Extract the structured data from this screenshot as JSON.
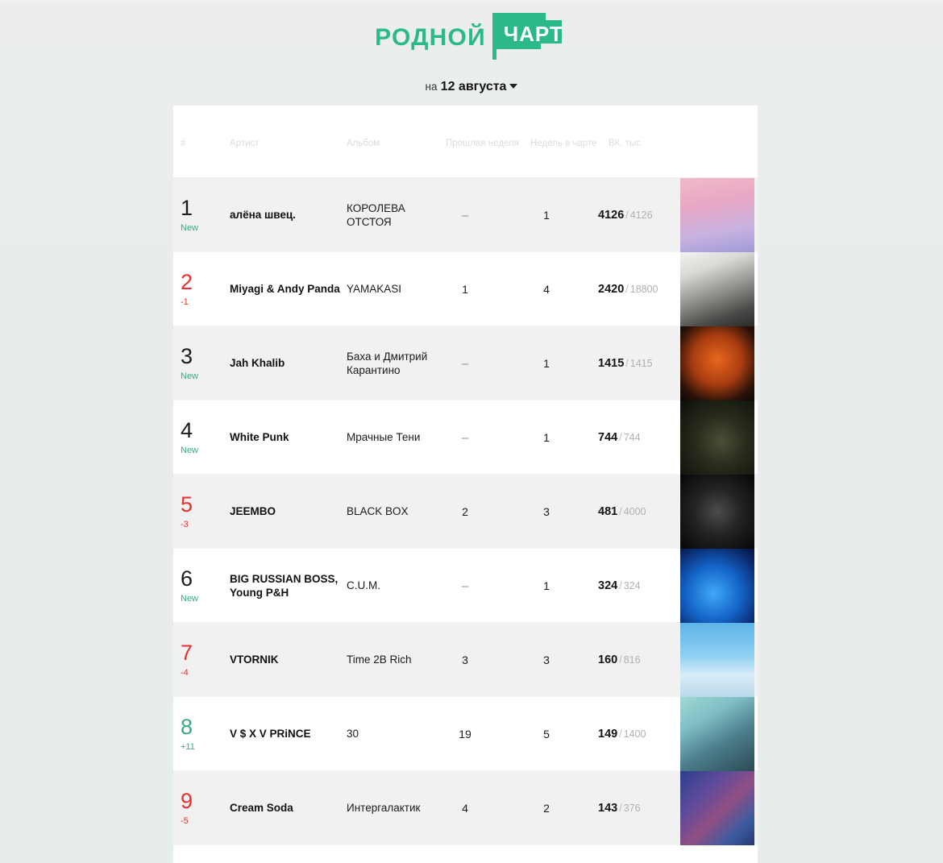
{
  "brand": {
    "word1": "РОДНОЙ",
    "word2": "ЧАРТ",
    "color": "#2bb98a"
  },
  "date_selector": {
    "prefix": "на",
    "value": "12 августа",
    "caret": "chevron-down-icon"
  },
  "table": {
    "headers": {
      "rank": "#",
      "artist": "Артист",
      "album": "Альбом",
      "prev_week": "Прошлая неделя",
      "weeks": "Недель в чарте",
      "vk": "ВК, тыс."
    },
    "rows": [
      {
        "rank": "1",
        "delta": "New",
        "delta_type": "new",
        "artist": "алёна швец.",
        "album": "КОРОЛЕВА ОТСТОЯ",
        "prev_week": "–",
        "weeks": "1",
        "vk_main": "4126",
        "vk_sep": "/",
        "vk_total": "4126",
        "art": "alena-shvets-koroleva-otstoya-cover"
      },
      {
        "rank": "2",
        "delta": "-1",
        "delta_type": "down",
        "artist": "Miyagi & Andy Panda",
        "album": "YAMAKASI",
        "prev_week": "1",
        "weeks": "4",
        "vk_main": "2420",
        "vk_sep": "/",
        "vk_total": "18800",
        "art": "miyagi-yamakasi-cover"
      },
      {
        "rank": "3",
        "delta": "New",
        "delta_type": "new",
        "artist": "Jah Khalib",
        "album": "Баха и Дмитрий Карантино",
        "prev_week": "–",
        "weeks": "1",
        "vk_main": "1415",
        "vk_sep": "/",
        "vk_total": "1415",
        "art": "jah-khalib-baha-cover"
      },
      {
        "rank": "4",
        "delta": "New",
        "delta_type": "new",
        "artist": "White Punk",
        "album": "Мрачные Тени",
        "prev_week": "–",
        "weeks": "1",
        "vk_main": "744",
        "vk_sep": "/",
        "vk_total": "744",
        "art": "white-punk-mrachnye-teni-cover"
      },
      {
        "rank": "5",
        "delta": "-3",
        "delta_type": "down",
        "artist": "JEEMBO",
        "album": "BLACK BOX",
        "prev_week": "2",
        "weeks": "3",
        "vk_main": "481",
        "vk_sep": "/",
        "vk_total": "4000",
        "art": "jeembo-black-box-cover"
      },
      {
        "rank": "6",
        "delta": "New",
        "delta_type": "new",
        "artist": "BIG RUSSIAN BOSS, Young P&H",
        "album": "C.U.M.",
        "prev_week": "–",
        "weeks": "1",
        "vk_main": "324",
        "vk_sep": "/",
        "vk_total": "324",
        "art": "big-russian-boss-cum-cover"
      },
      {
        "rank": "7",
        "delta": "-4",
        "delta_type": "down",
        "artist": "VTORNIK",
        "album": "Time 2B Rich",
        "prev_week": "3",
        "weeks": "3",
        "vk_main": "160",
        "vk_sep": "/",
        "vk_total": "816",
        "art": "vtornik-time-2b-rich-cover"
      },
      {
        "rank": "8",
        "delta": "+11",
        "delta_type": "up",
        "artist": "V $ X V PRiNCE",
        "album": "30",
        "prev_week": "19",
        "weeks": "5",
        "vk_main": "149",
        "vk_sep": "/",
        "vk_total": "1400",
        "art": "vsxv-prince-30-cover"
      },
      {
        "rank": "9",
        "delta": "-5",
        "delta_type": "down",
        "artist": "Cream Soda",
        "album": "Интергалактик",
        "prev_week": "4",
        "weeks": "2",
        "vk_main": "143",
        "vk_sep": "/",
        "vk_total": "376",
        "art": "cream-soda-intergalaktik-cover"
      }
    ]
  },
  "colors": {
    "accent_teal": "#3aa887",
    "down_red": "#e8312f",
    "page_bg": "#e9edec",
    "row_alt": "#f1f1f1"
  }
}
